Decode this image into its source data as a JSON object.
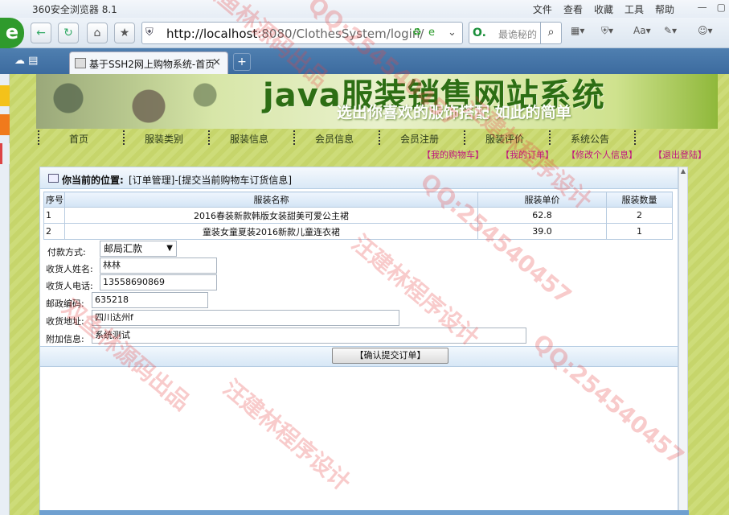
{
  "browser": {
    "title": "360安全浏览器 8.1",
    "menus": [
      "文件",
      "查看",
      "收藏",
      "工具",
      "帮助"
    ],
    "url_host": "http://localhost",
    "url_path": ":8080/ClothesSystem/login/",
    "search_placeholder": "最诡秘的",
    "tab_title": "基于SSH2网上购物系统-首页",
    "tab_close": "×",
    "new_tab": "+"
  },
  "site": {
    "banner_title": "java服装销售网站系统",
    "banner_sub": "选出你喜欢的服饰搭配 如此的简单",
    "main_menu": [
      "首页",
      "服装类别",
      "服装信息",
      "会员信息",
      "会员注册",
      "服装评价",
      "系统公告"
    ],
    "user_menu": [
      "【我的购物车】",
      "【我的订单】",
      "【修改个人信息】",
      "【退出登陆】"
    ]
  },
  "content": {
    "location_label": "你当前的位置:",
    "location_value": "[订单管理]-[提交当前购物车订货信息]",
    "table": {
      "headers": [
        "序号",
        "服装名称",
        "服装单价",
        "服装数量"
      ],
      "rows": [
        [
          "1",
          "2016春装新款韩版女装甜美可爱公主裙",
          "62.8",
          "2"
        ],
        [
          "2",
          "童装女童夏装2016新款儿童连衣裙",
          "39.0",
          "1"
        ]
      ]
    },
    "form": {
      "payment_label": "付款方式:",
      "payment_value": "邮局汇款",
      "name_label": "收货人姓名:",
      "name_value": "林林",
      "phone_label": "收货人电话:",
      "phone_value": "13558690869",
      "zip_label": "邮政编码:",
      "zip_value": "635218",
      "address_label": "收货地址:",
      "address_value": "四川达州f",
      "note_label": "附加信息:",
      "note_value": "系统测试",
      "submit_label": "【确认提交订单】"
    }
  },
  "watermarks": [
    "双鱼林源码出品",
    "QQ:254540457",
    "汪建林程序设计",
    "QQ:254540457",
    "双鱼林源码出品",
    "汪建林程序设计",
    "QQ:254540457",
    "汪建林程序设计"
  ]
}
